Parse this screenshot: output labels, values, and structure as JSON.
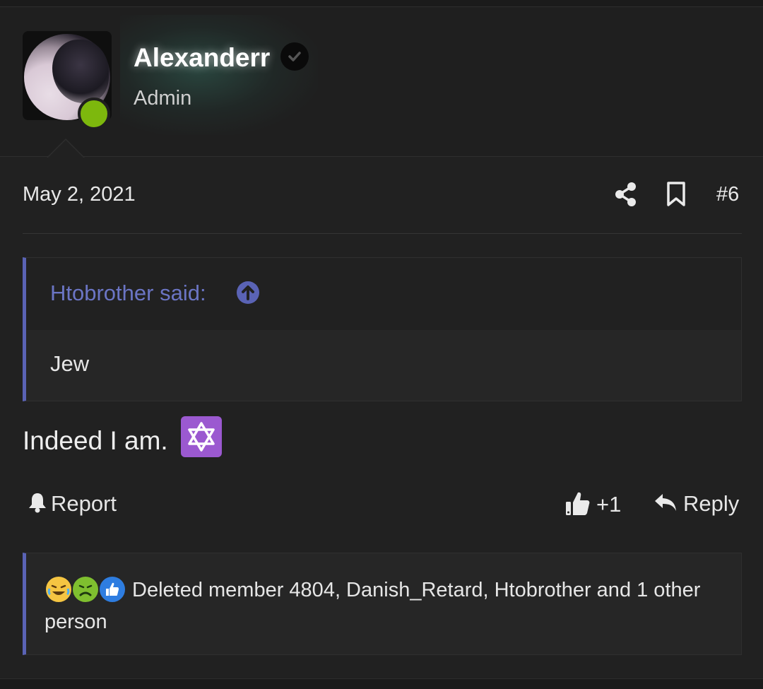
{
  "author": {
    "username": "Alexanderr",
    "title": "Admin"
  },
  "post": {
    "date": "May 2, 2021",
    "number": "#6",
    "text": "Indeed I am."
  },
  "quote": {
    "attribution": "Htobrother said:",
    "body": "Jew"
  },
  "actions": {
    "report_label": "Report",
    "like_count": "+1",
    "reply_label": "Reply"
  },
  "reactions": {
    "summary": "Deleted member 4804, Danish_Retard, Htobrother and 1 other person",
    "icons": [
      "laughing-crying-emoji",
      "sick-emoji",
      "thumbs-up-emoji"
    ]
  },
  "colors": {
    "accent": "#5a63b5",
    "quote_link": "#6b75c4",
    "online": "#7db80d",
    "star_bg": "#9b59d0",
    "background": "#212121"
  }
}
